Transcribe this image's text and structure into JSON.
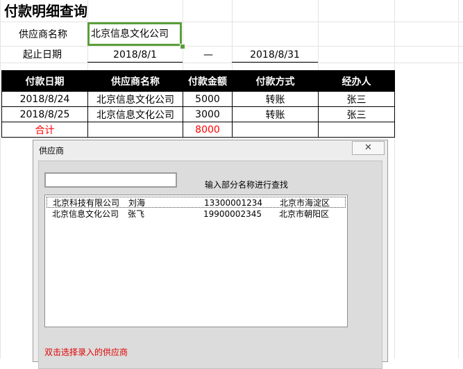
{
  "title": "付款明细查询",
  "form": {
    "supplier_label": "供应商名称",
    "supplier_value": "北京信息文化公司",
    "date_label": "起止日期",
    "start_date": "2018/8/1",
    "date_separator": "—",
    "end_date": "2018/8/31"
  },
  "table": {
    "headers": [
      "付款日期",
      "供应商名称",
      "付款金额",
      "付款方式",
      "经办人"
    ],
    "rows": [
      [
        "2018/8/24",
        "北京信息文化公司",
        "5000",
        "转账",
        "张三"
      ],
      [
        "2018/8/25",
        "北京信息文化公司",
        "3000",
        "转账",
        "张三"
      ]
    ],
    "total_label": "合计",
    "total_value": "8000"
  },
  "dialog": {
    "title": "供应商",
    "close_glyph": "✕",
    "search_value": "",
    "hint": "输入部分名称进行查找",
    "items": [
      {
        "name": "北京科技有限公司",
        "contact": "刘海",
        "phone": "13300001234",
        "district": "北京市海淀区"
      },
      {
        "name": "北京信息文化公司",
        "contact": "张飞",
        "phone": "19900002345",
        "district": "北京市朝阳区"
      }
    ],
    "footnote": "双击选择录入的供应商"
  },
  "colors": {
    "selection_border": "#5b9e3a",
    "header_bg": "#000000",
    "total_text": "#ff0000",
    "footnote_text": "#e00000"
  }
}
